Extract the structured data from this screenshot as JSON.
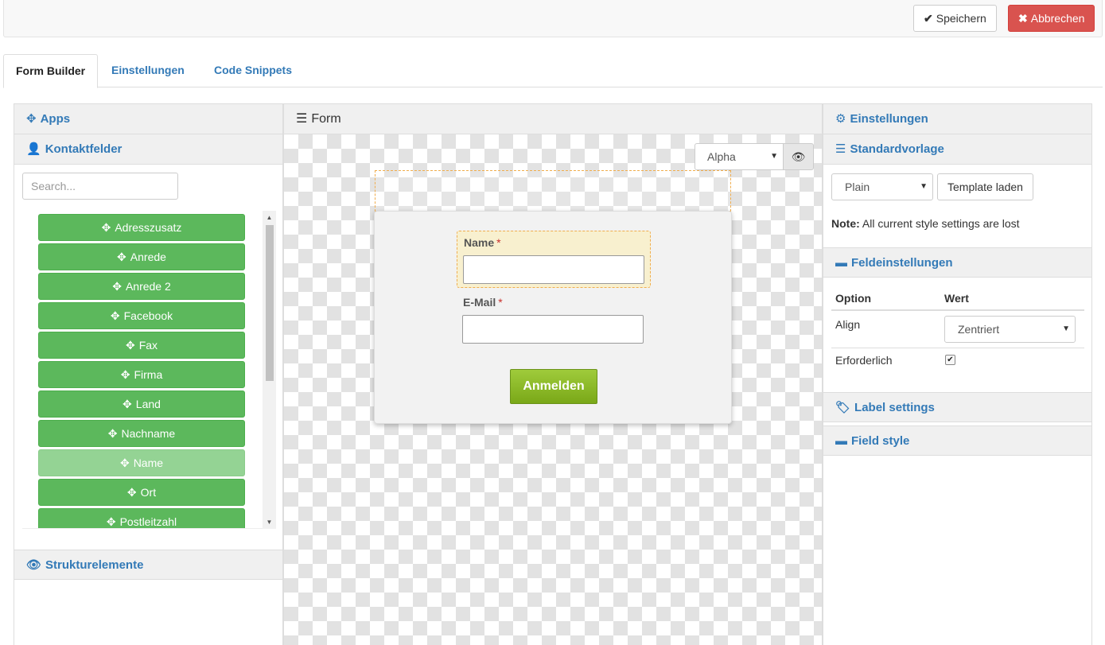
{
  "toolbar": {
    "save_label": "Speichern",
    "cancel_label": "Abbrechen"
  },
  "tabs": [
    {
      "label": "Form Builder",
      "active": true
    },
    {
      "label": "Einstellungen",
      "active": false
    },
    {
      "label": "Code Snippets",
      "active": false
    }
  ],
  "left_panel": {
    "apps_label": "Apps",
    "contacts_label": "Kontaktfelder",
    "search_placeholder": "Search...",
    "fields": [
      {
        "label": "Adresszusatz",
        "disabled": false
      },
      {
        "label": "Anrede",
        "disabled": false
      },
      {
        "label": "Anrede 2",
        "disabled": false
      },
      {
        "label": "Facebook",
        "disabled": false
      },
      {
        "label": "Fax",
        "disabled": false
      },
      {
        "label": "Firma",
        "disabled": false
      },
      {
        "label": "Land",
        "disabled": false
      },
      {
        "label": "Nachname",
        "disabled": false
      },
      {
        "label": "Name",
        "disabled": true
      },
      {
        "label": "Ort",
        "disabled": false
      },
      {
        "label": "Postleitzahl",
        "disabled": false
      }
    ],
    "structure_label": "Strukturelemente"
  },
  "center_panel": {
    "title": "Form",
    "theme_select": "Alpha",
    "form": {
      "fields": [
        {
          "label": "Name",
          "required_mark": "*",
          "selected": true
        },
        {
          "label": "E-Mail",
          "required_mark": "*",
          "selected": false
        }
      ],
      "submit_label": "Anmelden"
    }
  },
  "right_panel": {
    "settings_label": "Einstellungen",
    "template_label": "Standardvorlage",
    "template_select": "Plain",
    "template_button": "Template laden",
    "note_bold": "Note:",
    "note_text": "All current style settings are lost",
    "field_settings_label": "Feldeinstellungen",
    "table": {
      "col_option": "Option",
      "col_value": "Wert",
      "rows": [
        {
          "option": "Align",
          "value": "Zentriert"
        },
        {
          "option": "Erforderlich",
          "checked": true
        }
      ]
    },
    "label_settings_label": "Label settings",
    "field_style_label": "Field style"
  },
  "colors": {
    "primary": "#337ab7",
    "success": "#5cb85c",
    "danger": "#d9534f",
    "submit": "#8ab82a"
  }
}
